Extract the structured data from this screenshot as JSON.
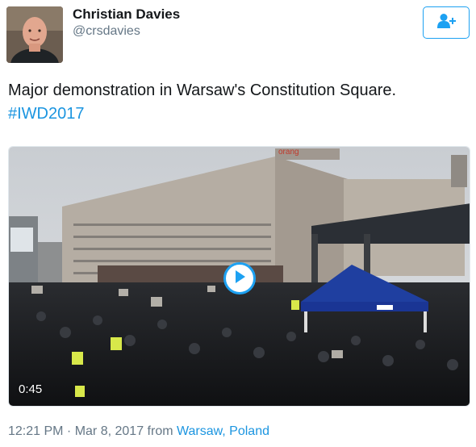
{
  "user": {
    "name": "Christian Davies",
    "handle": "@crsdavies"
  },
  "tweet": {
    "text": "Major demonstration in Warsaw's Constitution Square.",
    "hashtag": "#IWD2017"
  },
  "media": {
    "duration": "0:45",
    "sign_text": "orang"
  },
  "meta": {
    "time": "12:21 PM",
    "separator": " · ",
    "date": "Mar 8, 2017",
    "from_label": " from ",
    "location": "Warsaw, Poland"
  },
  "colors": {
    "link": "#1b95e0",
    "accent": "#1da1f2",
    "text": "#14171a",
    "muted": "#657786"
  },
  "icons": {
    "follow": "add-user-icon",
    "play": "play-icon"
  }
}
